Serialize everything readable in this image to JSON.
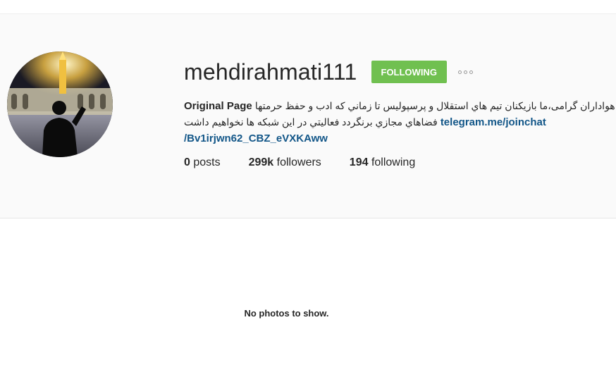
{
  "profile": {
    "username": "mehdirahmati111",
    "follow_button_label": "FOLLOWING",
    "more_options_icon": "ellipsis-icon",
    "avatar_icon": "profile-photo",
    "bio": {
      "title": "Original Page",
      "rtl_line_1": "به هواداران گرامی،ما بازیکنان تیم هاي استقلال و پرسپولیس تا زماني که ادب و حفظ حرمتها",
      "rtl_line_2": "فضاهاي مجازي برنگردد فعاليتي در اين شبكه ها نخواهيم داشت",
      "link_part_1": "telegram.me/joinchat",
      "link_part_2": "/Bv1irjwn62_CBZ_eVXKAww"
    },
    "stats": {
      "posts_count": "0",
      "posts_label": "posts",
      "followers_count": "299k",
      "followers_label": "followers",
      "following_count": "194",
      "following_label": "following"
    }
  },
  "content": {
    "empty_message": "No photos to show."
  },
  "colors": {
    "follow_button": "#70c050",
    "link": "#125688",
    "header_bg": "#fafafa"
  }
}
